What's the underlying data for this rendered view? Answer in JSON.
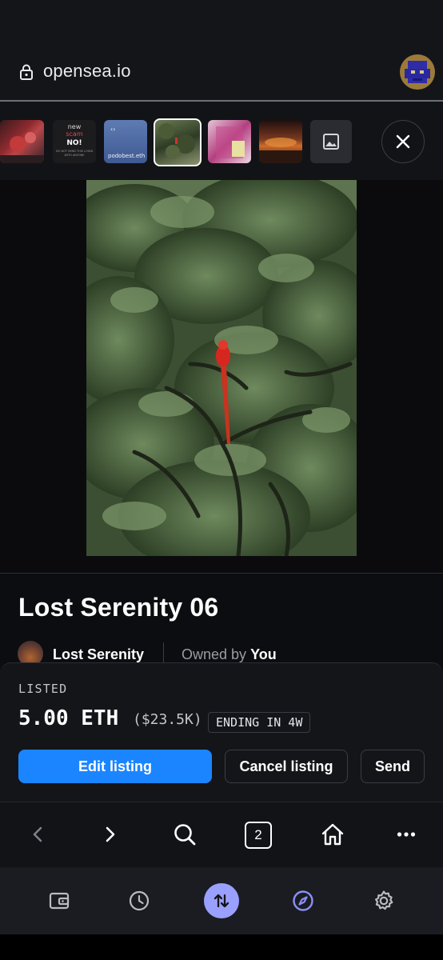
{
  "browser": {
    "url": "opensea.io",
    "tab_count": "2"
  },
  "thumbnails": [
    {
      "id": "thumb-1",
      "selected": false
    },
    {
      "id": "thumb-2",
      "selected": false,
      "text": [
        "new",
        "scam",
        "NO!",
        "DO NOT SEND THIS LOGIN",
        "WITH ANYONE"
      ]
    },
    {
      "id": "thumb-3",
      "selected": false,
      "text": [
        "podobest.eth"
      ]
    },
    {
      "id": "thumb-4",
      "selected": true
    },
    {
      "id": "thumb-5",
      "selected": false
    },
    {
      "id": "thumb-6",
      "selected": false
    },
    {
      "id": "thumb-7",
      "selected": false,
      "icon": "image-placeholder-icon"
    }
  ],
  "nft": {
    "title": "Lost Serenity 06",
    "collection": "Lost Serenity",
    "owned_by_prefix": "Owned by",
    "owner": "You"
  },
  "listing": {
    "status_label": "LISTED",
    "price": "5.00 ETH",
    "price_usd": "($23.5K)",
    "ending_badge": "ENDING IN 4W",
    "edit_label": "Edit listing",
    "cancel_label": "Cancel listing",
    "send_label": "Send"
  },
  "browser_nav": {
    "icons": [
      "back-icon",
      "forward-icon",
      "search-icon",
      "tabs-icon",
      "home-icon",
      "more-icon"
    ]
  },
  "tabbar": {
    "icons": [
      "wallet-icon",
      "history-icon",
      "swap-icon",
      "browser-compass-icon",
      "settings-icon"
    ],
    "active": "browser-compass-icon"
  },
  "colors": {
    "accent_blue": "#1b85ff",
    "swap_purple": "#9aa0ff",
    "compass_active": "#8a8ff5"
  }
}
